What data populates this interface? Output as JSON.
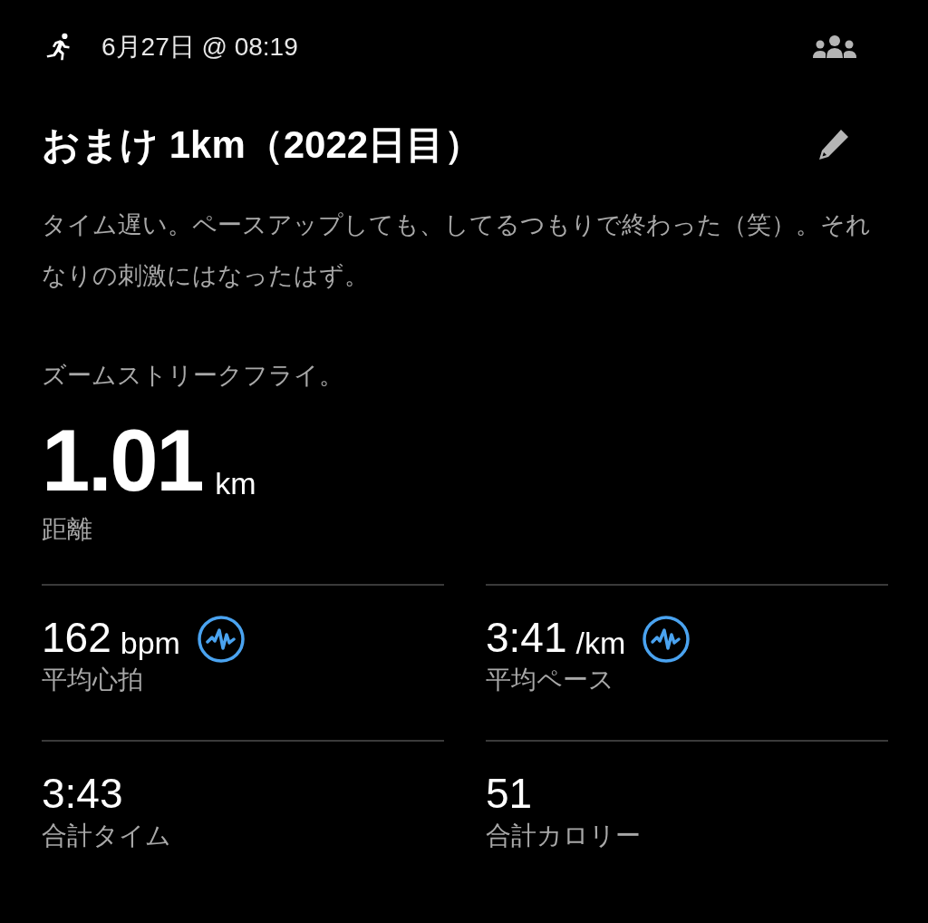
{
  "header": {
    "date": "6月27日 @ 08:19"
  },
  "title": "おまけ 1km（2022日目）",
  "description": [
    "タイム遅い。ペースアップしても、してるつもりで終わった（笑）。それなりの刺激にはなったはず。",
    "ズームストリークフライ。"
  ],
  "distance": {
    "value": "1.01",
    "unit": "km",
    "label": "距離"
  },
  "stats": [
    {
      "kind": "analysis",
      "value": "162",
      "unit": "bpm",
      "label": "平均心拍"
    },
    {
      "kind": "analysis",
      "value": "3:41",
      "unit": "/km",
      "label": "平均ペース"
    },
    {
      "kind": "plain",
      "value": "3:43",
      "label": "合計タイム"
    },
    {
      "kind": "plain",
      "value": "51",
      "label": "合計カロリー"
    }
  ]
}
